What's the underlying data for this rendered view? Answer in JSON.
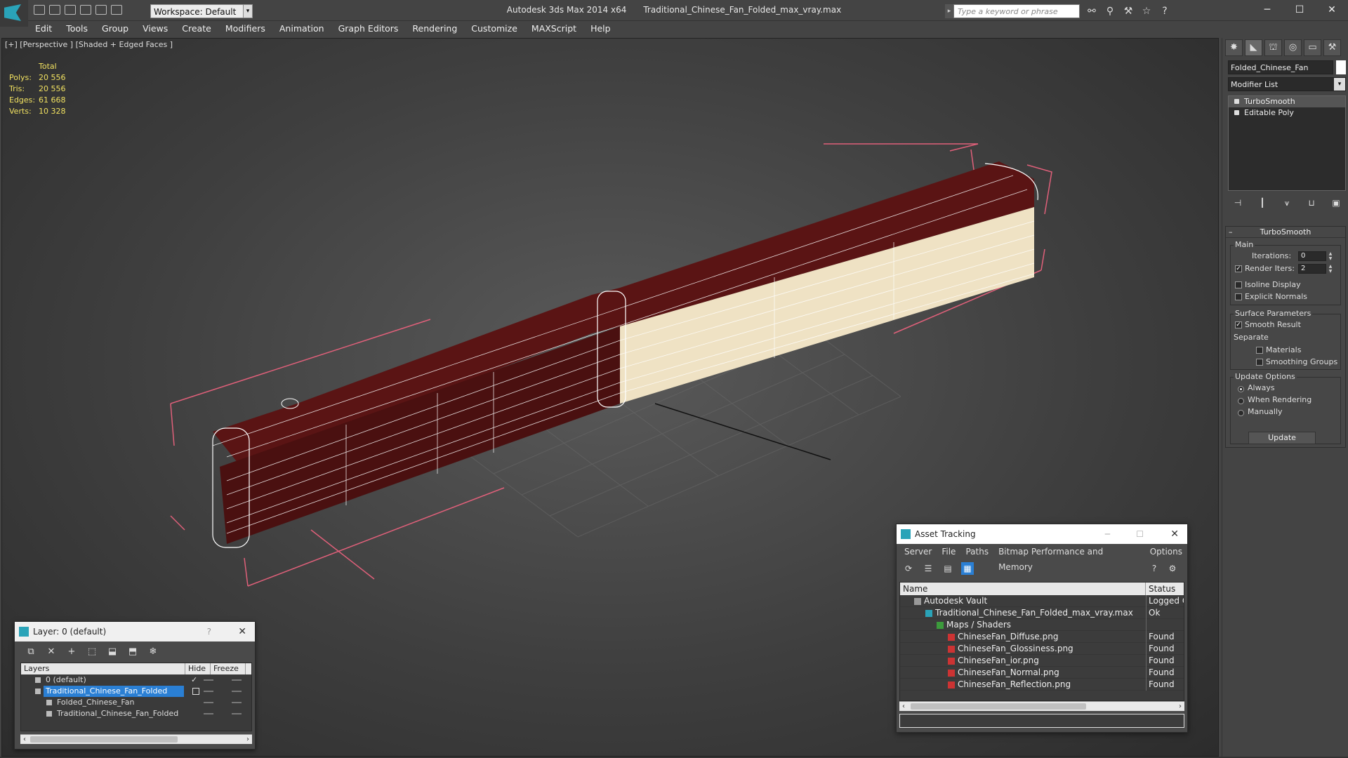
{
  "app": {
    "title": "Autodesk 3ds Max  2014 x64",
    "file": "Traditional_Chinese_Fan_Folded_max_vray.max",
    "workspace": "Workspace: Default",
    "search_placeholder": "Type a keyword or phrase",
    "minimize": "─",
    "maximize": "☐",
    "close": "✕"
  },
  "menu": [
    "Edit",
    "Tools",
    "Group",
    "Views",
    "Create",
    "Modifiers",
    "Animation",
    "Graph Editors",
    "Rendering",
    "Customize",
    "MAXScript",
    "Help"
  ],
  "viewport": {
    "label": "[+] [Perspective ] [Shaded + Edged Faces ]",
    "stats": {
      "header": "Total",
      "rows": [
        {
          "k": "Polys:",
          "v": "20 556"
        },
        {
          "k": "Tris:",
          "v": "20 556"
        },
        {
          "k": "Edges:",
          "v": "61 668"
        },
        {
          "k": "Verts:",
          "v": "10 328"
        }
      ]
    }
  },
  "command_panel": {
    "object_name": "Folded_Chinese_Fan",
    "modifier_list": "Modifier List",
    "stack": [
      "TurboSmooth",
      "Editable Poly"
    ],
    "turbosmooth": {
      "title": "TurboSmooth",
      "main": "Main",
      "iterations_label": "Iterations:",
      "iterations": "0",
      "render_iters_label": "Render Iters:",
      "render_iters": "2",
      "isoline": "Isoline Display",
      "explicit_normals": "Explicit Normals",
      "surface_params": "Surface Parameters",
      "smooth_result": "Smooth Result",
      "separate": "Separate",
      "materials": "Materials",
      "smoothing_groups": "Smoothing Groups",
      "update_options": "Update Options",
      "always": "Always",
      "when_rendering": "When Rendering",
      "manually": "Manually",
      "update": "Update"
    }
  },
  "layer_dialog": {
    "title": "Layer: 0 (default)",
    "help": "?",
    "close": "✕",
    "columns": [
      "Layers",
      "Hide",
      "Freeze"
    ],
    "rows": [
      {
        "name": "0 (default)",
        "indent": 0,
        "selected": false
      },
      {
        "name": "Traditional_Chinese_Fan_Folded",
        "indent": 0,
        "selected": true
      },
      {
        "name": "Folded_Chinese_Fan",
        "indent": 1,
        "selected": false
      },
      {
        "name": "Traditional_Chinese_Fan_Folded",
        "indent": 1,
        "selected": false
      }
    ]
  },
  "asset_tracking": {
    "title": "Asset Tracking",
    "menu": [
      "Server",
      "File",
      "Paths",
      "Bitmap Performance and Memory",
      "Options"
    ],
    "columns": [
      "Name",
      "Status"
    ],
    "rows": [
      {
        "name": "Autodesk Vault",
        "status": "Logged O",
        "level": 0,
        "icon": "vault-icon"
      },
      {
        "name": "Traditional_Chinese_Fan_Folded_max_vray.max",
        "status": "Ok",
        "level": 1,
        "icon": "max-file-icon"
      },
      {
        "name": "Maps / Shaders",
        "status": "",
        "level": 2,
        "icon": "maps-icon"
      },
      {
        "name": "ChineseFan_Diffuse.png",
        "status": "Found",
        "level": 3,
        "icon": "png-icon"
      },
      {
        "name": "ChineseFan_Glossiness.png",
        "status": "Found",
        "level": 3,
        "icon": "png-icon"
      },
      {
        "name": "ChineseFan_ior.png",
        "status": "Found",
        "level": 3,
        "icon": "png-icon"
      },
      {
        "name": "ChineseFan_Normal.png",
        "status": "Found",
        "level": 3,
        "icon": "png-icon"
      },
      {
        "name": "ChineseFan_Reflection.png",
        "status": "Found",
        "level": 3,
        "icon": "png-icon"
      }
    ]
  },
  "colors": {
    "accent": "#2a7fd4",
    "stats_text": "#f0e060",
    "fan_wood": "#5a1414",
    "fan_paper": "#efe2c4",
    "bbox": "#e0607a"
  }
}
